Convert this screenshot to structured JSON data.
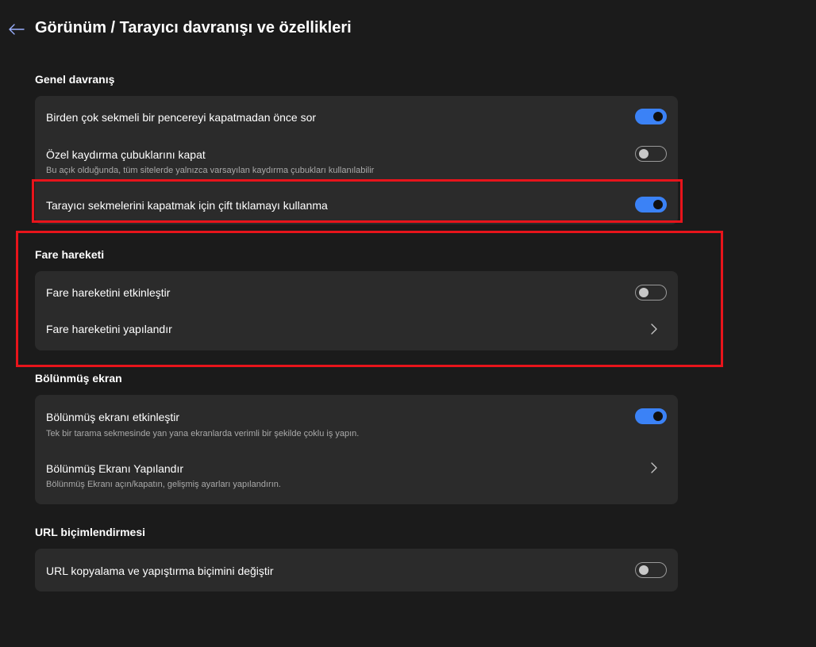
{
  "header": {
    "title": "Görünüm / Tarayıcı davranışı ve özellikleri"
  },
  "sections": {
    "general": {
      "title": "Genel davranış",
      "rows": [
        {
          "label": "Birden çok sekmeli bir pencereyi kapatmadan önce sor",
          "toggle": "on"
        },
        {
          "label": "Özel kaydırma çubuklarını kapat",
          "description": "Bu açık olduğunda, tüm sitelerde yalnızca varsayılan kaydırma çubukları kullanılabilir",
          "toggle": "off"
        },
        {
          "label": "Tarayıcı sekmelerini kapatmak için çift tıklamayı kullanma",
          "toggle": "on"
        }
      ]
    },
    "mouse_gesture": {
      "title": "Fare hareketi",
      "rows": [
        {
          "label": "Fare hareketini etkinleştir",
          "toggle": "off"
        },
        {
          "label": "Fare hareketini yapılandır",
          "action": "chevron-right"
        }
      ]
    },
    "split_screen": {
      "title": "Bölünmüş ekran",
      "rows": [
        {
          "label": "Bölünmüş ekranı etkinleştir",
          "description": "Tek bir tarama sekmesinde yan yana ekranlarda verimli bir şekilde çoklu iş yapın.",
          "toggle": "on"
        },
        {
          "label": "Bölünmüş Ekranı Yapılandır",
          "description": "Bölünmüş Ekranı açın/kapatın, gelişmiş ayarları yapılandırın.",
          "action": "chevron-right"
        }
      ]
    },
    "url_formatting": {
      "title": "URL biçimlendirmesi",
      "rows": [
        {
          "label": "URL kopyalama ve yapıştırma biçimini değiştir",
          "toggle": "off"
        }
      ]
    }
  },
  "colors": {
    "background": "#1b1b1b",
    "card": "#2b2b2b",
    "accent": "#3b82f6",
    "highlight": "#e8141b"
  },
  "icons": {
    "back": "arrow-left-icon",
    "chevron": "chevron-right-icon"
  }
}
